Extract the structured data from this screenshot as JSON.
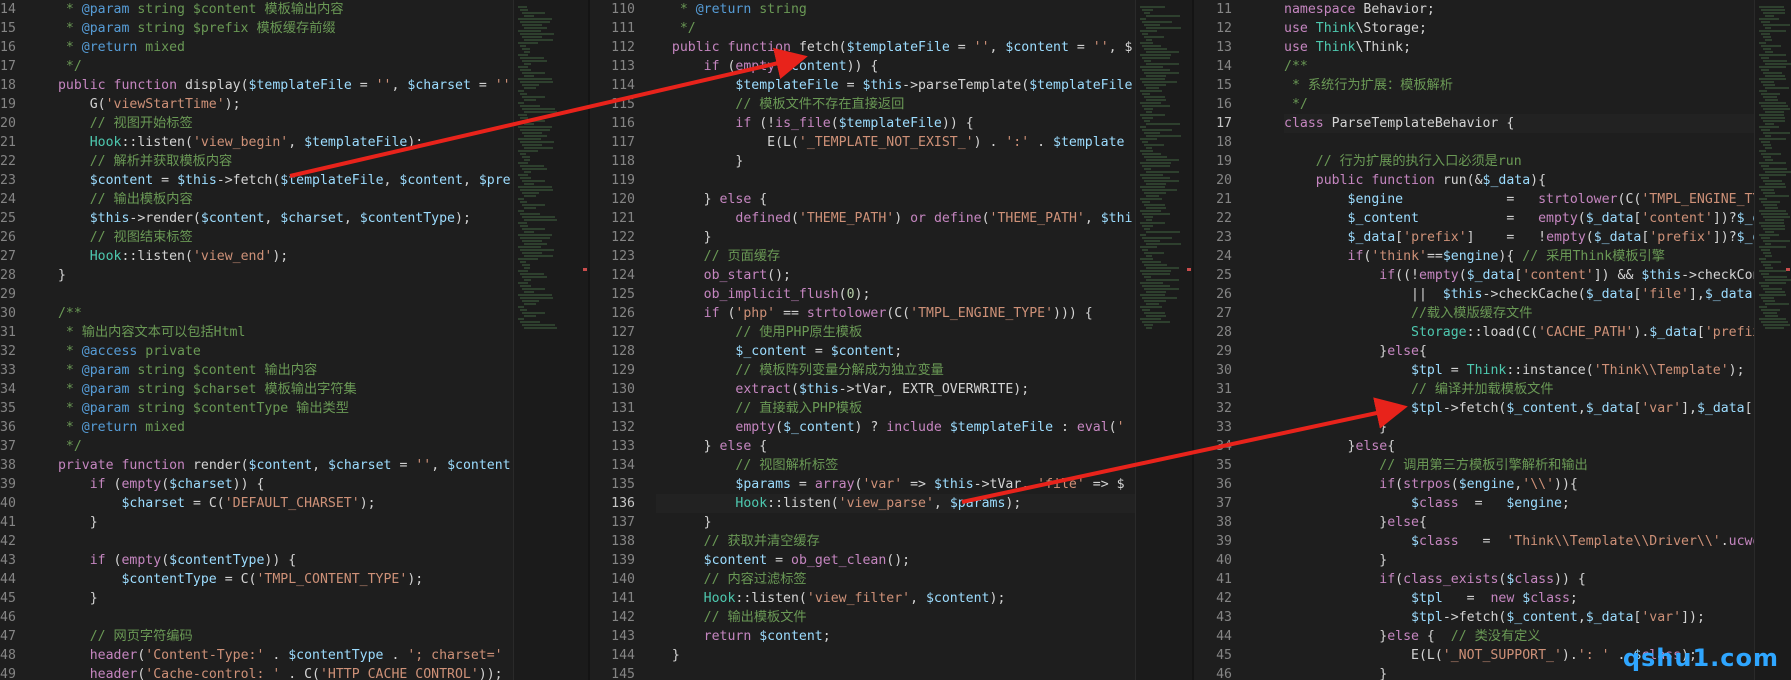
{
  "panes": [
    {
      "name": "left",
      "current_line": null,
      "lines": [
        {
          "n": "14",
          "t": "  * @param string $content 模板输出内容"
        },
        {
          "n": "15",
          "t": "  * @param string $prefix 模板缓存前缀"
        },
        {
          "n": "16",
          "t": "  * @return mixed"
        },
        {
          "n": "17",
          "t": "  */"
        },
        {
          "n": "18",
          "t": " public function display($templateFile = '', $charset = ''"
        },
        {
          "n": "19",
          "t": "     G('viewStartTime');"
        },
        {
          "n": "20",
          "t": "     // 视图开始标签"
        },
        {
          "n": "21",
          "t": "     Hook::listen('view_begin', $templateFile);"
        },
        {
          "n": "22",
          "t": "     // 解析并获取模板内容"
        },
        {
          "n": "23",
          "t": "     $content = $this->fetch($templateFile, $content, $pre"
        },
        {
          "n": "24",
          "t": "     // 输出模板内容"
        },
        {
          "n": "25",
          "t": "     $this->render($content, $charset, $contentType);"
        },
        {
          "n": "26",
          "t": "     // 视图结束标签"
        },
        {
          "n": "27",
          "t": "     Hook::listen('view_end');"
        },
        {
          "n": "28",
          "t": " }"
        },
        {
          "n": "29",
          "t": ""
        },
        {
          "n": "30",
          "t": " /**"
        },
        {
          "n": "31",
          "t": "  * 输出内容文本可以包括Html"
        },
        {
          "n": "32",
          "t": "  * @access private"
        },
        {
          "n": "33",
          "t": "  * @param string $content 输出内容"
        },
        {
          "n": "34",
          "t": "  * @param string $charset 模板输出字符集"
        },
        {
          "n": "35",
          "t": "  * @param string $contentType 输出类型"
        },
        {
          "n": "36",
          "t": "  * @return mixed"
        },
        {
          "n": "37",
          "t": "  */"
        },
        {
          "n": "38",
          "t": " private function render($content, $charset = '', $content"
        },
        {
          "n": "39",
          "t": "     if (empty($charset)) {"
        },
        {
          "n": "40",
          "t": "         $charset = C('DEFAULT_CHARSET');"
        },
        {
          "n": "41",
          "t": "     }"
        },
        {
          "n": "42",
          "t": ""
        },
        {
          "n": "43",
          "t": "     if (empty($contentType)) {"
        },
        {
          "n": "44",
          "t": "         $contentType = C('TMPL_CONTENT_TYPE');"
        },
        {
          "n": "45",
          "t": "     }"
        },
        {
          "n": "46",
          "t": ""
        },
        {
          "n": "47",
          "t": "     // 网页字符编码"
        },
        {
          "n": "48",
          "t": "     header('Content-Type:' . $contentType . '; charset='"
        },
        {
          "n": "49",
          "t": "     header('Cache-control: ' . C('HTTP_CACHE_CONTROL'));"
        }
      ]
    },
    {
      "name": "middle",
      "current_line": "136",
      "lines": [
        {
          "n": "110",
          "t": "   * @return string"
        },
        {
          "n": "111",
          "t": "   */"
        },
        {
          "n": "112",
          "t": "  public function fetch($templateFile = '', $content = '', $"
        },
        {
          "n": "113",
          "t": "      if (empty($content)) {"
        },
        {
          "n": "114",
          "t": "          $templateFile = $this->parseTemplate($templateFile"
        },
        {
          "n": "115",
          "t": "          // 模板文件不存在直接返回"
        },
        {
          "n": "116",
          "t": "          if (!is_file($templateFile)) {"
        },
        {
          "n": "117",
          "t": "              E(L('_TEMPLATE_NOT_EXIST_') . ':' . $template"
        },
        {
          "n": "118",
          "t": "          }"
        },
        {
          "n": "119",
          "t": ""
        },
        {
          "n": "120",
          "t": "      } else {"
        },
        {
          "n": "121",
          "t": "          defined('THEME_PATH') or define('THEME_PATH', $thi"
        },
        {
          "n": "122",
          "t": "      }"
        },
        {
          "n": "123",
          "t": "      // 页面缓存"
        },
        {
          "n": "124",
          "t": "      ob_start();"
        },
        {
          "n": "125",
          "t": "      ob_implicit_flush(0);"
        },
        {
          "n": "126",
          "t": "      if ('php' == strtolower(C('TMPL_ENGINE_TYPE'))) {"
        },
        {
          "n": "127",
          "t": "          // 使用PHP原生模板"
        },
        {
          "n": "128",
          "t": "          $_content = $content;"
        },
        {
          "n": "129",
          "t": "          // 模板阵列变量分解成为独立变量"
        },
        {
          "n": "130",
          "t": "          extract($this->tVar, EXTR_OVERWRITE);"
        },
        {
          "n": "131",
          "t": "          // 直接载入PHP模板"
        },
        {
          "n": "132",
          "t": "          empty($_content) ? include $templateFile : eval('"
        },
        {
          "n": "133",
          "t": "      } else {"
        },
        {
          "n": "134",
          "t": "          // 视图解析标签"
        },
        {
          "n": "135",
          "t": "          $params = array('var' => $this->tVar, 'file' => $"
        },
        {
          "n": "136",
          "t": "          Hook::listen('view_parse', $params);"
        },
        {
          "n": "137",
          "t": "      }"
        },
        {
          "n": "138",
          "t": "      // 获取并清空缓存"
        },
        {
          "n": "139",
          "t": "      $content = ob_get_clean();"
        },
        {
          "n": "140",
          "t": "      // 内容过滤标签"
        },
        {
          "n": "141",
          "t": "      Hook::listen('view_filter', $content);"
        },
        {
          "n": "142",
          "t": "      // 输出模板文件"
        },
        {
          "n": "143",
          "t": "      return $content;"
        },
        {
          "n": "144",
          "t": "  }"
        },
        {
          "n": "145",
          "t": ""
        }
      ]
    },
    {
      "name": "right",
      "current_line": "17",
      "lines": [
        {
          "n": "11",
          "t": "namespace Behavior;"
        },
        {
          "n": "12",
          "t": "use Think\\Storage;"
        },
        {
          "n": "13",
          "t": "use Think\\Think;"
        },
        {
          "n": "14",
          "t": "/**"
        },
        {
          "n": "15",
          "t": " * 系统行为扩展：模板解析"
        },
        {
          "n": "16",
          "t": " */"
        },
        {
          "n": "17",
          "t": "class ParseTemplateBehavior {"
        },
        {
          "n": "18",
          "t": ""
        },
        {
          "n": "19",
          "t": "    // 行为扩展的执行入口必须是run"
        },
        {
          "n": "20",
          "t": "    public function run(&$_data){"
        },
        {
          "n": "21",
          "t": "        $engine             =   strtolower(C('TMPL_ENGINE_TYPE"
        },
        {
          "n": "22",
          "t": "        $_content           =   empty($_data['content'])?$_da"
        },
        {
          "n": "23",
          "t": "        $_data['prefix']    =   !empty($_data['prefix'])?$_da"
        },
        {
          "n": "24",
          "t": "        if('think'==$engine){ // 采用Think模板引擎"
        },
        {
          "n": "25",
          "t": "            if((!empty($_data['content']) && $this->checkConte"
        },
        {
          "n": "26",
          "t": "                ||  $this->checkCache($_data['file'],$_data['p"
        },
        {
          "n": "27",
          "t": "                //载入模版缓存文件"
        },
        {
          "n": "28",
          "t": "                Storage::load(C('CACHE_PATH').$_data['prefix']"
        },
        {
          "n": "29",
          "t": "            }else{"
        },
        {
          "n": "30",
          "t": "                $tpl = Think::instance('Think\\\\Template');"
        },
        {
          "n": "31",
          "t": "                // 编译并加载模板文件"
        },
        {
          "n": "32",
          "t": "                $tpl->fetch($_content,$_data['var'],$_data['pr"
        },
        {
          "n": "33",
          "t": "            }"
        },
        {
          "n": "34",
          "t": "        }else{"
        },
        {
          "n": "35",
          "t": "            // 调用第三方模板引擎解析和输出"
        },
        {
          "n": "36",
          "t": "            if(strpos($engine,'\\\\')){"
        },
        {
          "n": "37",
          "t": "                $class  =   $engine;"
        },
        {
          "n": "38",
          "t": "            }else{"
        },
        {
          "n": "39",
          "t": "                $class   =  'Think\\\\Template\\\\Driver\\\\'.ucword"
        },
        {
          "n": "40",
          "t": "            }"
        },
        {
          "n": "41",
          "t": "            if(class_exists($class)) {"
        },
        {
          "n": "42",
          "t": "                $tpl   =  new $class;"
        },
        {
          "n": "43",
          "t": "                $tpl->fetch($_content,$_data['var']);"
        },
        {
          "n": "44",
          "t": "            }else {  // 类没有定义"
        },
        {
          "n": "45",
          "t": "                E(L('_NOT_SUPPORT_').': ' . $class);"
        },
        {
          "n": "46",
          "t": "            }"
        }
      ]
    }
  ],
  "annotation_color": "#e8231b",
  "watermark": "qshu1.com",
  "watermark_color": "#2fa6ff"
}
